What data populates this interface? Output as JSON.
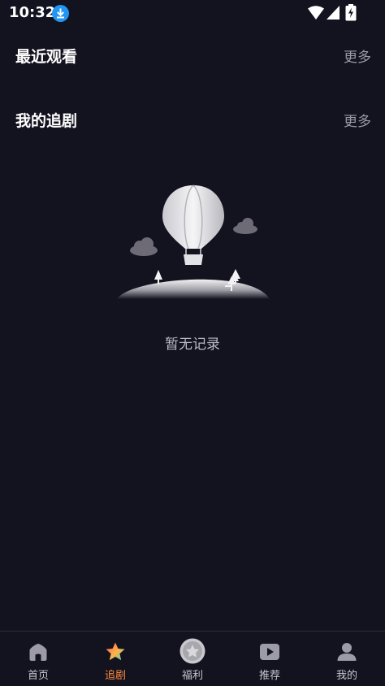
{
  "status_bar": {
    "time": "10:32"
  },
  "sections": {
    "recent": {
      "title": "最近观看",
      "more_label": "更多"
    },
    "following": {
      "title": "我的追剧",
      "more_label": "更多"
    }
  },
  "empty_state": {
    "text": "暂无记录"
  },
  "tab_bar": {
    "active": "追剧",
    "items": [
      {
        "label": "首页",
        "icon": "home-icon"
      },
      {
        "label": "追剧",
        "icon": "star-icon"
      },
      {
        "label": "福利",
        "icon": "gift-icon"
      },
      {
        "label": "推荐",
        "icon": "play-icon"
      },
      {
        "label": "我的",
        "icon": "user-icon"
      }
    ]
  },
  "colors": {
    "background": "#13121f",
    "accent": "#ff8a3d",
    "muted_text": "#9a99a4"
  }
}
